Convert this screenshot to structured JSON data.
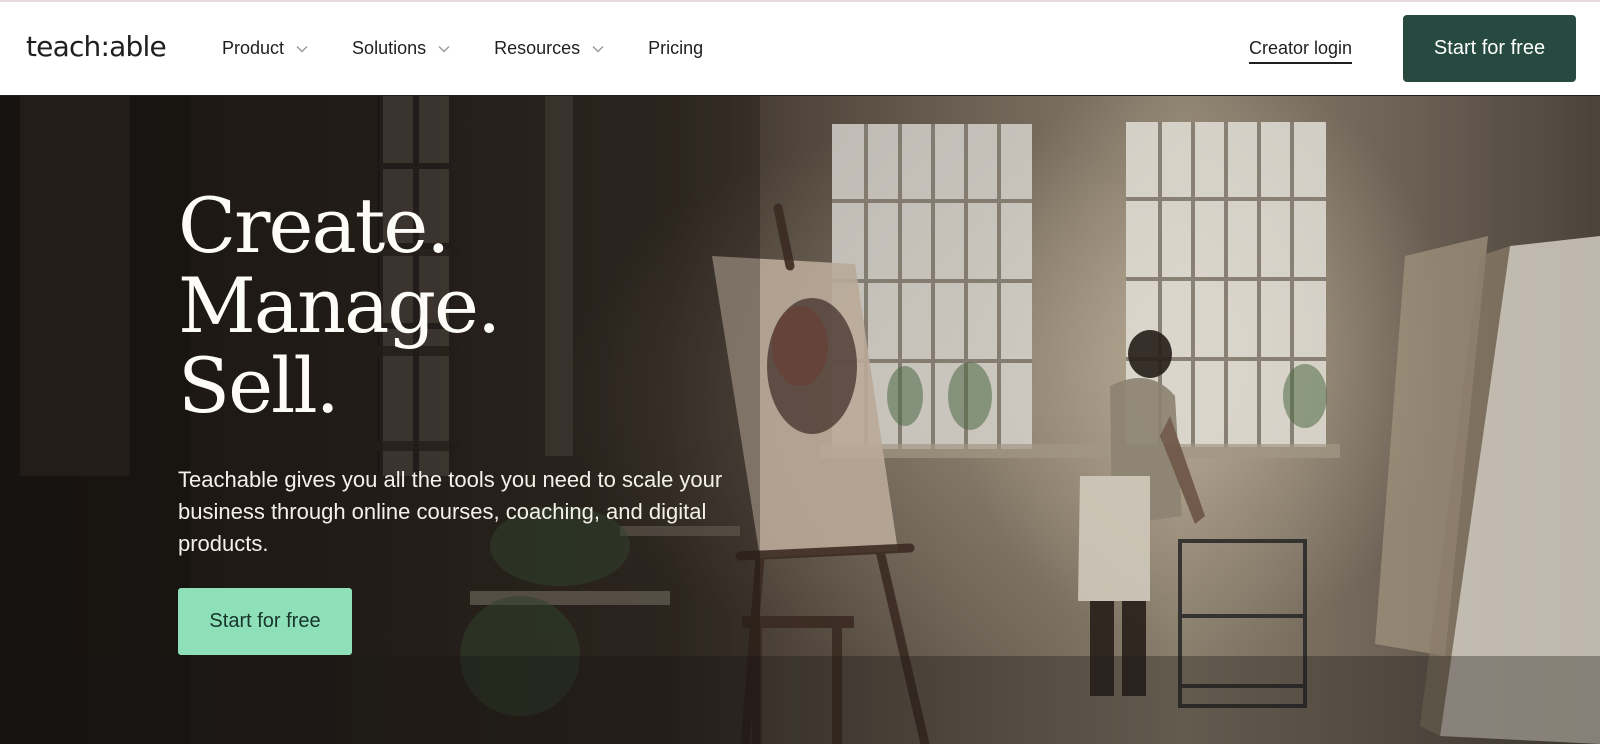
{
  "brand": {
    "logo_text": "teach:able"
  },
  "nav": {
    "items": [
      {
        "label": "Product",
        "has_dropdown": true
      },
      {
        "label": "Solutions",
        "has_dropdown": true
      },
      {
        "label": "Resources",
        "has_dropdown": true
      },
      {
        "label": "Pricing",
        "has_dropdown": false
      }
    ],
    "creator_login": "Creator login",
    "cta": "Start for free"
  },
  "hero": {
    "headline": [
      "Create.",
      "Manage.",
      "Sell."
    ],
    "subcopy": "Teachable gives you all the tools you need to scale your business through online courses, coaching, and digital products.",
    "cta": "Start for free"
  },
  "colors": {
    "nav_cta_bg": "#274a40",
    "hero_cta_bg": "#8ee0b8",
    "text_dark": "#1f1f1f",
    "hero_text": "#fdfcf8"
  },
  "icons": {
    "dropdown": "chevron-down-icon"
  }
}
